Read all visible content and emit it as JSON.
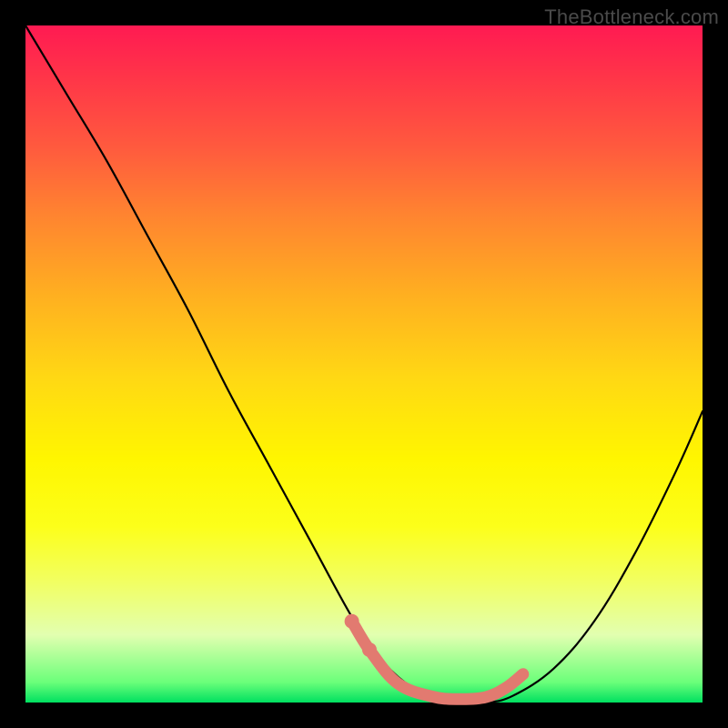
{
  "watermark": "TheBottleneck.com",
  "chart_data": {
    "type": "line",
    "title": "",
    "xlabel": "",
    "ylabel": "",
    "xlim": [
      0,
      100
    ],
    "ylim": [
      0,
      100
    ],
    "grid": false,
    "legend": false,
    "series": [
      {
        "name": "bottleneck-curve",
        "x": [
          0,
          6,
          12,
          18,
          24,
          30,
          36,
          42,
          48,
          52,
          56,
          60,
          64,
          68,
          72,
          78,
          84,
          90,
          96,
          100
        ],
        "y": [
          100,
          90,
          80,
          69,
          58,
          46,
          35,
          24,
          13,
          7,
          3,
          1,
          0,
          0,
          1,
          5,
          12,
          22,
          34,
          43
        ]
      }
    ],
    "highlight_segment": {
      "x": [
        48.5,
        51,
        55,
        60,
        64,
        68,
        71,
        73.5
      ],
      "y": [
        11.5,
        7.5,
        2.8,
        0.9,
        0.5,
        0.8,
        2.2,
        4.2
      ]
    },
    "highlight_dots": [
      {
        "x": 48.2,
        "y": 12.0
      },
      {
        "x": 50.8,
        "y": 7.8
      }
    ],
    "gradient_stops": [
      {
        "pos": 0,
        "color": "#ff1a52"
      },
      {
        "pos": 50,
        "color": "#ffe000"
      },
      {
        "pos": 95,
        "color": "#e2ffb0"
      },
      {
        "pos": 100,
        "color": "#00e060"
      }
    ]
  }
}
